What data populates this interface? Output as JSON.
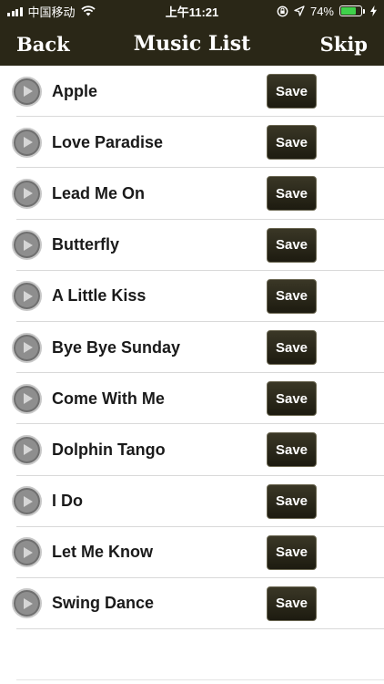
{
  "status_bar": {
    "carrier": "中国移动",
    "time": "上午11:21",
    "battery_percent": "74%",
    "battery_level": 0.74,
    "icons": [
      "signal-icon",
      "wifi-icon",
      "lock-rotation-icon",
      "location-icon",
      "battery-icon",
      "charging-icon"
    ]
  },
  "nav": {
    "back_label": "Back",
    "title": "Music List",
    "skip_label": "Skip"
  },
  "songs": [
    {
      "title": "Apple",
      "save_label": "Save"
    },
    {
      "title": "Love Paradise",
      "save_label": "Save"
    },
    {
      "title": "Lead Me On",
      "save_label": "Save"
    },
    {
      "title": "Butterfly",
      "save_label": "Save"
    },
    {
      "title": "A Little Kiss",
      "save_label": "Save"
    },
    {
      "title": "Bye Bye Sunday",
      "save_label": "Save"
    },
    {
      "title": "Come With Me",
      "save_label": "Save"
    },
    {
      "title": "Dolphin Tango",
      "save_label": "Save"
    },
    {
      "title": "I Do",
      "save_label": "Save"
    },
    {
      "title": "Let Me Know",
      "save_label": "Save"
    },
    {
      "title": "Swing Dance",
      "save_label": "Save"
    }
  ],
  "colors": {
    "bar_background": "#2a2717",
    "battery_fill": "#3fd24a",
    "save_button": "#2a2717"
  }
}
